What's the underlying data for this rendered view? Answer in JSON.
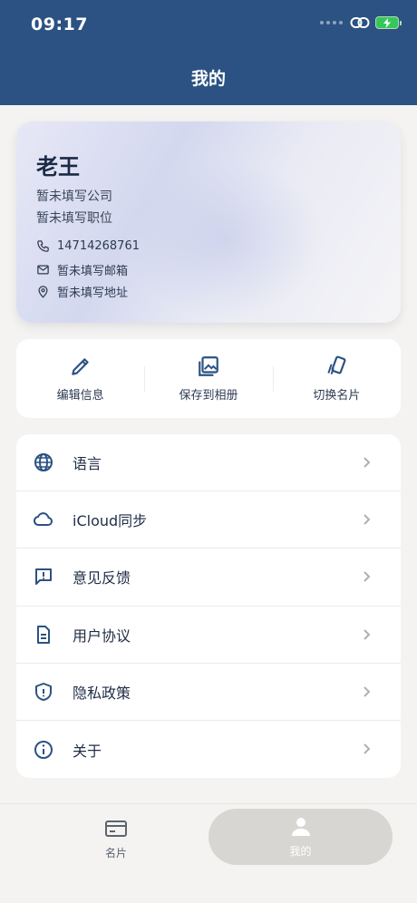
{
  "status": {
    "time": "09:17"
  },
  "header": {
    "title": "我的"
  },
  "profile": {
    "name": "老王",
    "company": "暂未填写公司",
    "position": "暂未填写职位",
    "phone": "14714268761",
    "email": "暂未填写邮箱",
    "address": "暂未填写地址"
  },
  "actions": [
    {
      "label": "编辑信息",
      "icon": "pencil-icon"
    },
    {
      "label": "保存到相册",
      "icon": "gallery-icon"
    },
    {
      "label": "切换名片",
      "icon": "cards-switch-icon"
    }
  ],
  "menu": [
    {
      "label": "语言",
      "icon": "globe-icon"
    },
    {
      "label": "iCloud同步",
      "icon": "cloud-icon"
    },
    {
      "label": "意见反馈",
      "icon": "feedback-icon"
    },
    {
      "label": "用户协议",
      "icon": "document-icon"
    },
    {
      "label": "隐私政策",
      "icon": "shield-icon"
    },
    {
      "label": "关于",
      "icon": "info-icon"
    }
  ],
  "tabs": [
    {
      "label": "名片",
      "icon": "card-icon",
      "active": false
    },
    {
      "label": "我的",
      "icon": "person-icon",
      "active": true
    }
  ],
  "colors": {
    "header": "#2b5282",
    "accent": "#2b5282",
    "battery": "#35c759"
  }
}
